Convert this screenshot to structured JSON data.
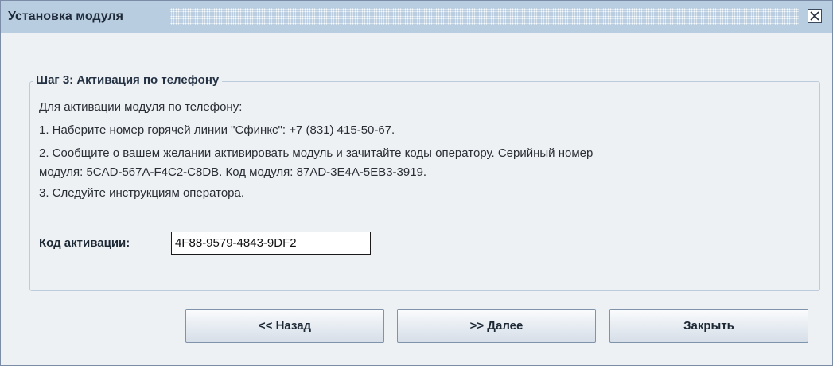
{
  "window": {
    "title": "Установка модуля"
  },
  "step": {
    "heading": "Шаг 3: Активация по телефону",
    "lines": [
      "Для активации модуля по телефону:",
      "1. Наберите номер горячей линии \"Сфинкс\": +7 (831) 415-50-67.",
      "2. Сообщите о вашем желании активировать модуль и зачитайте коды оператору. Серийный номер",
      "модуля: 5CAD-567A-F4C2-C8DB. Код модуля: 87AD-3E4A-5EB3-3919.",
      "3. Следуйте инструкциям оператора."
    ]
  },
  "activation": {
    "label": "Код активации:",
    "value": "4F88-9579-4843-9DF2"
  },
  "buttons": {
    "back": "<< Назад",
    "next": ">> Далее",
    "close": "Закрыть"
  },
  "icons": {
    "close": "close-icon"
  }
}
